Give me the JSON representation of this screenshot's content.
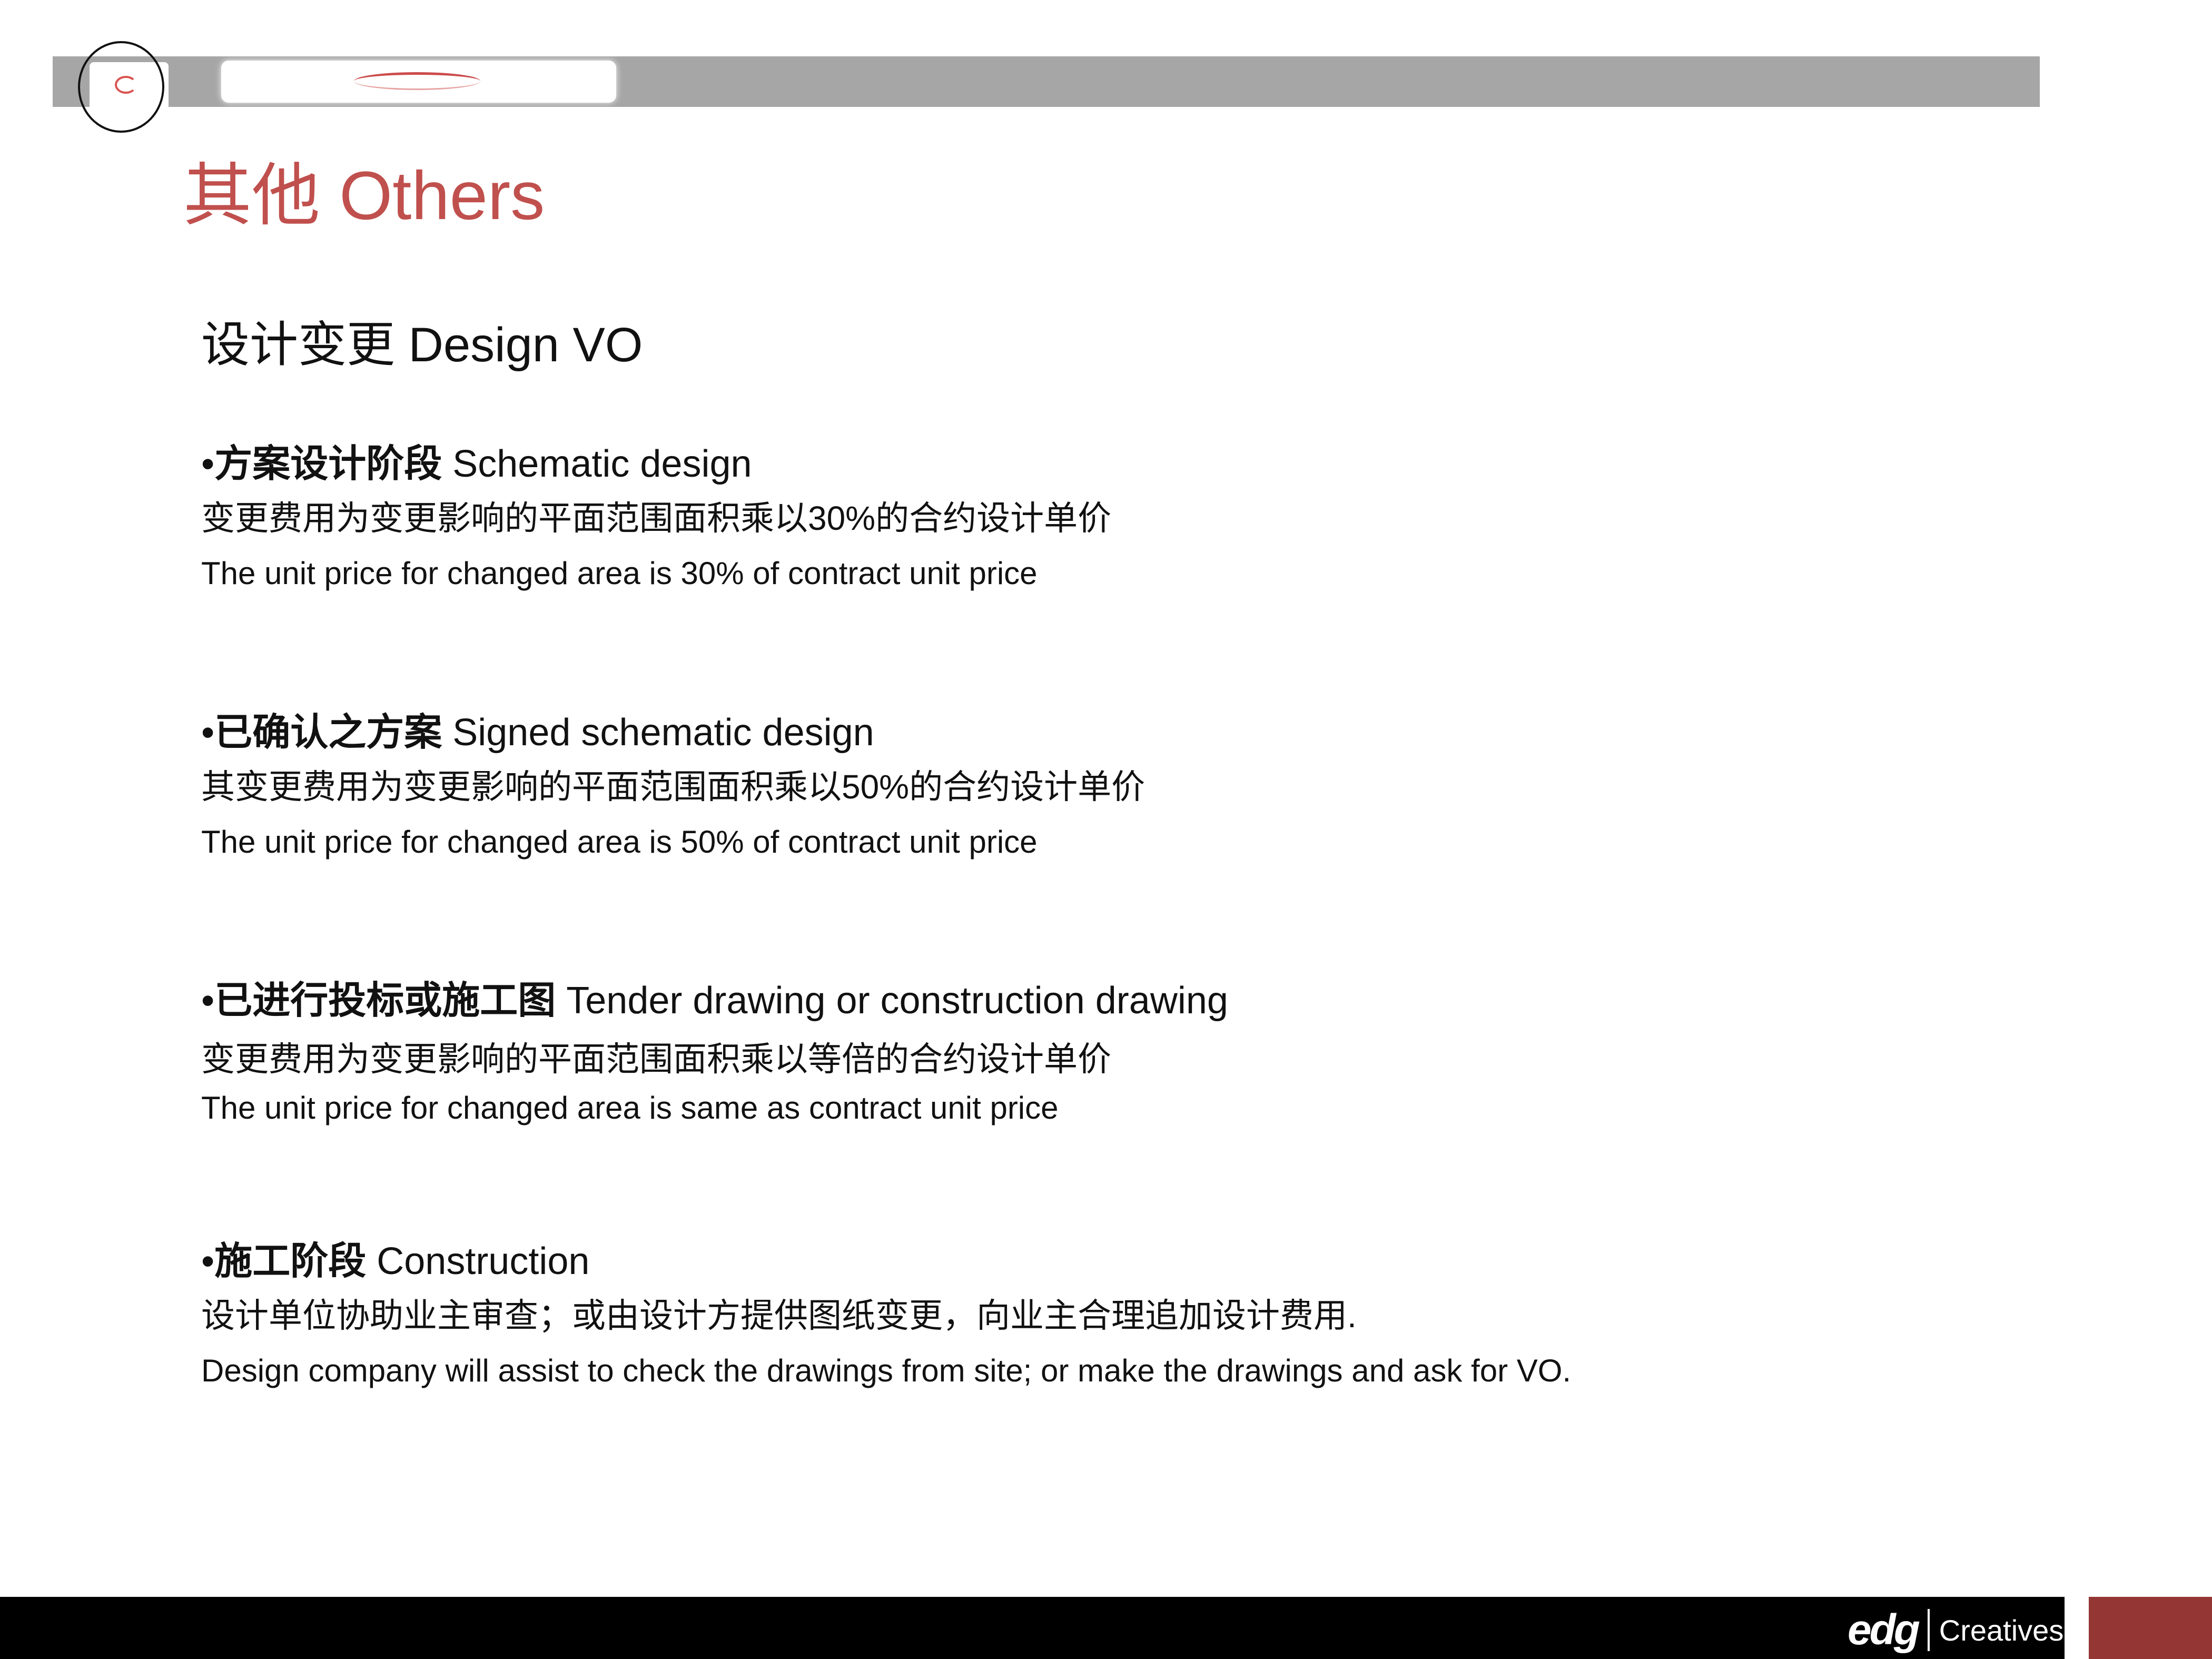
{
  "header": {
    "page_title": "其他 Others"
  },
  "section": {
    "title": "设计变更 Design VO"
  },
  "items": [
    {
      "bullet": "•",
      "heading_zh": "方案设计阶段",
      "heading_en": " Schematic design",
      "zh": "变更费用为变更影响的平面范围面积乘以30%的合约设计单价",
      "en": "The unit price for changed area is 30% of contract unit price"
    },
    {
      "bullet": "•",
      "heading_zh": "已确认之方案",
      "heading_en": " Signed schematic design",
      "zh": "其变更费用为变更影响的平面范围面积乘以50%的合约设计单价",
      "en": "The unit price for changed area is 50% of contract unit price"
    },
    {
      "bullet": "•",
      "heading_zh": "已进行投标或施工图",
      "heading_en": " Tender drawing or construction drawing",
      "zh": "变更费用为变更影响的平面范围面积乘以等倍的合约设计单价",
      "en": "The unit price for changed area is same as contract unit price"
    },
    {
      "bullet": "•",
      "heading_zh": "施工阶段",
      "heading_en": "  Construction",
      "zh": "设计单位协助业主审查；或由设计方提供图纸变更，向业主合理追加设计费用.",
      "en": "Design company will assist to check the drawings from site; or make the drawings and ask for VO."
    }
  ],
  "footer": {
    "brand": "edg",
    "sub": "Creatives"
  },
  "colors": {
    "accent_red": "#c0504d",
    "footer_accent": "#943634",
    "top_bar": "#a6a6a6"
  }
}
